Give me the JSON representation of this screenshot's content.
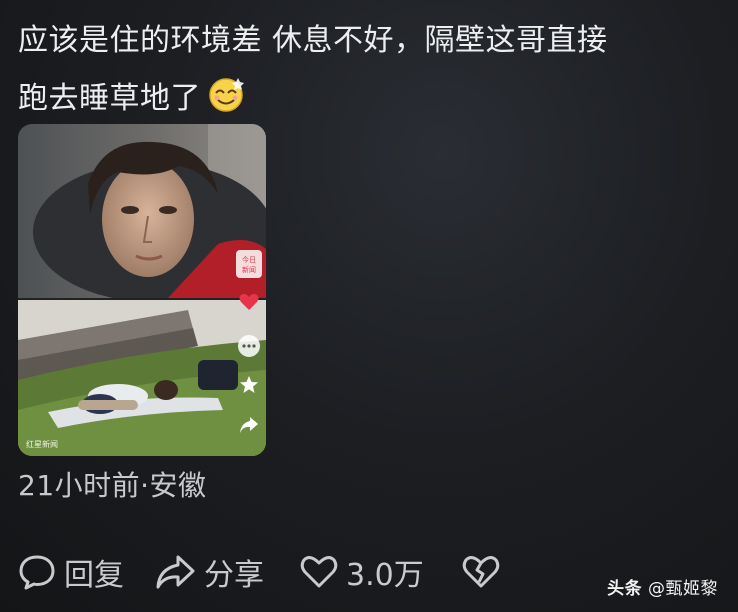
{
  "comment": {
    "line1": "应该是住的环境差 休息不好，隔壁这哥直接",
    "line2": "跑去睡草地了",
    "emoji": "smiling-face-emoji"
  },
  "media": {
    "top_badge": "今日\n新闻",
    "bottom_caption": "红星新闻",
    "side_icons": [
      "heart-icon",
      "more-icon",
      "star-icon",
      "share-icon"
    ]
  },
  "meta": {
    "time_location": "21小时前·安徽"
  },
  "actions": {
    "reply_label": "回复",
    "share_label": "分享",
    "like_count": "3.0万"
  },
  "watermark": {
    "app": "头条",
    "author": "@甄姬黎"
  },
  "colors": {
    "background": "#1c1e22",
    "text": "#eceef0",
    "secondary": "#c8c9cc",
    "accent_red": "#e8344a"
  }
}
